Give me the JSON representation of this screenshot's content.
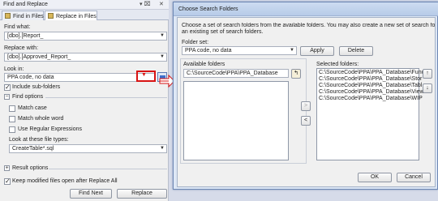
{
  "find_replace": {
    "title": "Find and Replace",
    "title_controls": [
      "▾ ⌧",
      "✕"
    ],
    "tabs": [
      {
        "label": "Find in Files"
      },
      {
        "label": "Replace in Files"
      }
    ],
    "find_label": "Find what:",
    "find_value": "[dbo].[Report_",
    "replace_label": "Replace with:",
    "replace_value": "[dbo].[Approved_Report_",
    "look_in_label": "Look in:",
    "look_in_value": "PPA code, no data",
    "include_subfolders": "Include sub-folders",
    "find_options": "Find options",
    "match_case": "Match case",
    "match_whole_word": "Match whole word",
    "use_regex": "Use Regular Expressions",
    "file_types_label": "Look at these file types:",
    "file_types_value": "CreateTable*.sql",
    "result_options": "Result options",
    "keep_modified": "Keep modified files open after Replace All",
    "find_next": "Find Next",
    "replace": "Replace"
  },
  "dialog": {
    "title": "Choose Search Folders",
    "description_line1": "Choose a set of search folders from the available folders. You may also create a new set of search folders or modify",
    "description_line2": "an existing set of search folders.",
    "folder_set_label": "Folder set:",
    "folder_set_value": "PPA code, no data",
    "apply": "Apply",
    "delete": "Delete",
    "available_label": "Available folders",
    "available_path": "C:\\SourceCode\\PPA\\PPA_Database",
    "selected_label": "Selected folders:",
    "selected_items": [
      "C:\\SourceCode\\PPA\\PPA_Database\\Func",
      "C:\\SourceCode\\PPA\\PPA_Database\\Stor",
      "C:\\SourceCode\\PPA\\PPA_Database\\Tabl",
      "C:\\SourceCode\\PPA\\PPA_Database\\View",
      "C:\\SourceCode\\PPA\\PPA_Database\\WIP"
    ],
    "add_arrow": ">",
    "remove_arrow": "<",
    "up_arrow": "↑",
    "down_arrow": "↓",
    "ok": "OK",
    "cancel": "Cancel"
  },
  "colors": {
    "highlight": "#d81414",
    "dialog_border": "#6d87b3"
  }
}
